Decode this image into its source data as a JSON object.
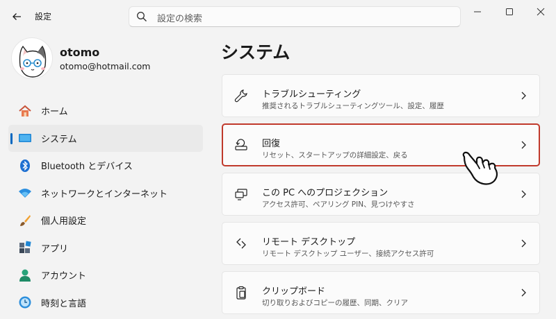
{
  "app": {
    "title": "設定"
  },
  "search": {
    "placeholder": "設定の検索"
  },
  "profile": {
    "name": "otomo",
    "email": "otomo@hotmail.com"
  },
  "sidebar": {
    "items": [
      {
        "label": "ホーム",
        "icon": "home-icon",
        "selected": false
      },
      {
        "label": "システム",
        "icon": "system-icon",
        "selected": true
      },
      {
        "label": "Bluetooth とデバイス",
        "icon": "bluetooth-icon",
        "selected": false
      },
      {
        "label": "ネットワークとインターネット",
        "icon": "wifi-icon",
        "selected": false
      },
      {
        "label": "個人用設定",
        "icon": "brush-icon",
        "selected": false
      },
      {
        "label": "アプリ",
        "icon": "apps-icon",
        "selected": false
      },
      {
        "label": "アカウント",
        "icon": "account-icon",
        "selected": false
      },
      {
        "label": "時刻と言語",
        "icon": "time-language-icon",
        "selected": false
      }
    ]
  },
  "main": {
    "title": "システム",
    "cards": [
      {
        "title": "トラブルシューティング",
        "subtitle": "推奨されるトラブルシューティングツール、設定、履歴",
        "icon": "wrench-icon"
      },
      {
        "title": "回復",
        "subtitle": "リセット、スタートアップの詳細設定、戻る",
        "icon": "recovery-icon",
        "highlighted": true
      },
      {
        "title": "この PC へのプロジェクション",
        "subtitle": "アクセス許可、ペアリング PIN、見つけやすさ",
        "icon": "projection-icon"
      },
      {
        "title": "リモート デスクトップ",
        "subtitle": "リモート デスクトップ ユーザー、接続アクセス許可",
        "icon": "remote-desktop-icon"
      },
      {
        "title": "クリップボード",
        "subtitle": "切り取りおよびコピーの履歴、同期、クリア",
        "icon": "clipboard-icon"
      }
    ]
  },
  "colors": {
    "accent": "#0067c0",
    "highlight_border": "#c0392b",
    "background": "#f3f3f3",
    "card": "#fbfbfb"
  }
}
